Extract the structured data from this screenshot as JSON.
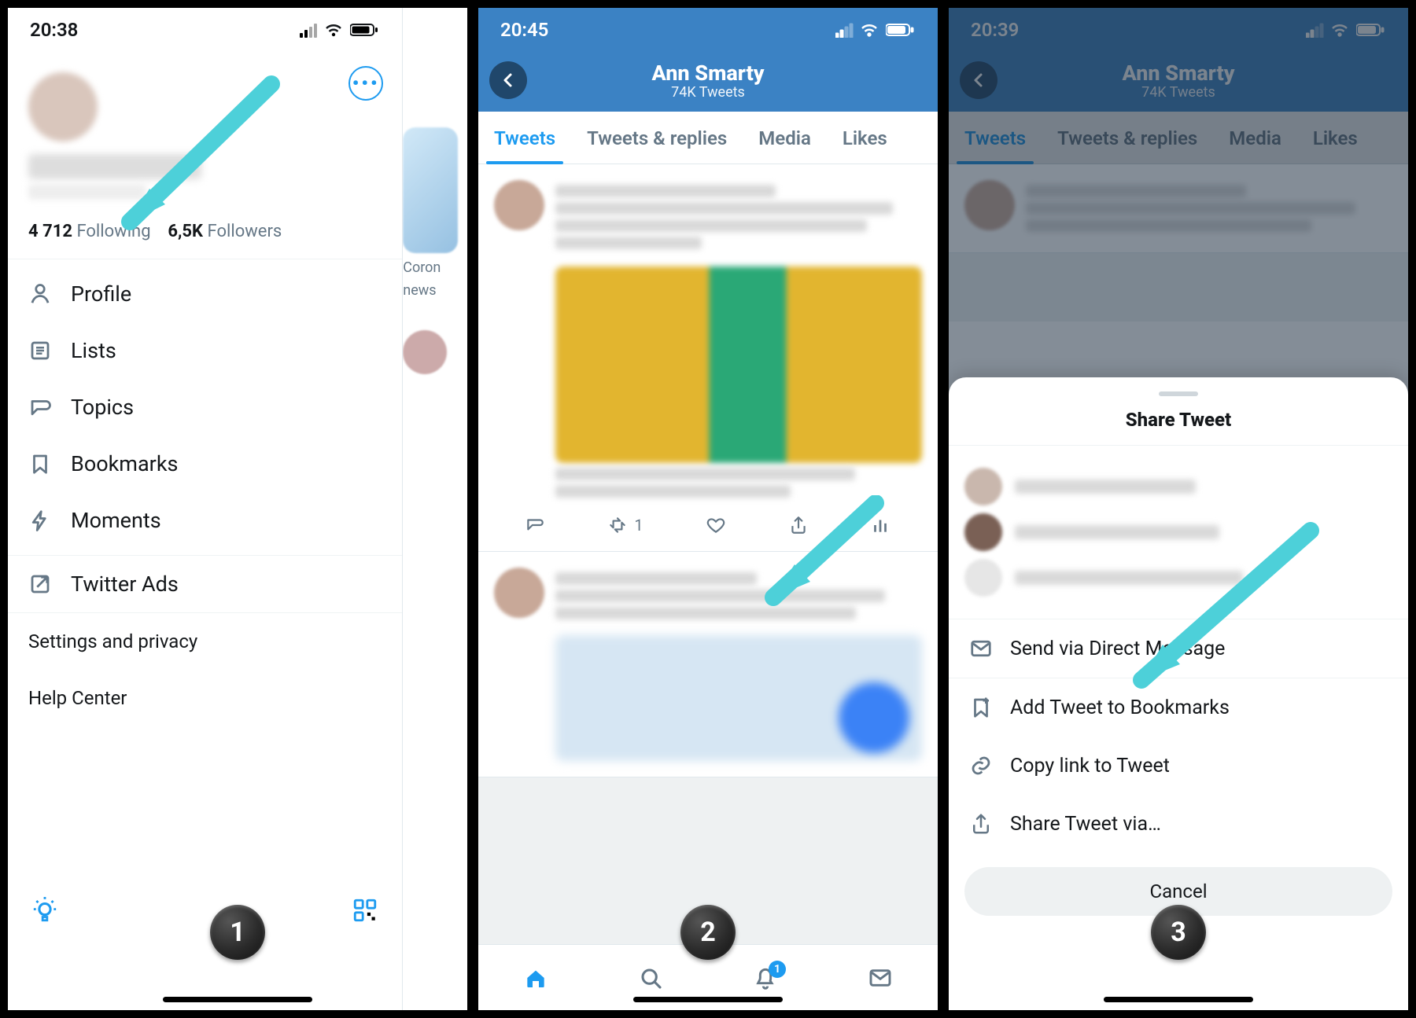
{
  "panel1": {
    "status_time": "20:38",
    "following_count": "4 712",
    "following_label": "Following",
    "followers_count": "6,5K",
    "followers_label": "Followers",
    "menu": {
      "profile": "Profile",
      "lists": "Lists",
      "topics": "Topics",
      "bookmarks": "Bookmarks",
      "moments": "Moments",
      "ads": "Twitter Ads"
    },
    "settings": "Settings and privacy",
    "help": "Help Center",
    "sliver_label1": "Coron",
    "sliver_label2": "news",
    "step": "1"
  },
  "panel2": {
    "status_time": "20:45",
    "profile_name": "Ann Smarty",
    "profile_sub": "74K Tweets",
    "tabs": {
      "tweets": "Tweets",
      "replies": "Tweets & replies",
      "media": "Media",
      "likes": "Likes"
    },
    "retweet_count": "1",
    "step": "2"
  },
  "panel3": {
    "status_time": "20:39",
    "profile_name": "Ann Smarty",
    "profile_sub": "74K Tweets",
    "tabs": {
      "tweets": "Tweets",
      "replies": "Tweets & replies",
      "media": "Media",
      "likes": "Likes"
    },
    "sheet_title": "Share Tweet",
    "actions": {
      "dm": "Send via Direct Message",
      "bookmark": "Add Tweet to Bookmarks",
      "copy": "Copy link to Tweet",
      "sharevia": "Share Tweet via…"
    },
    "cancel": "Cancel",
    "step": "3"
  }
}
